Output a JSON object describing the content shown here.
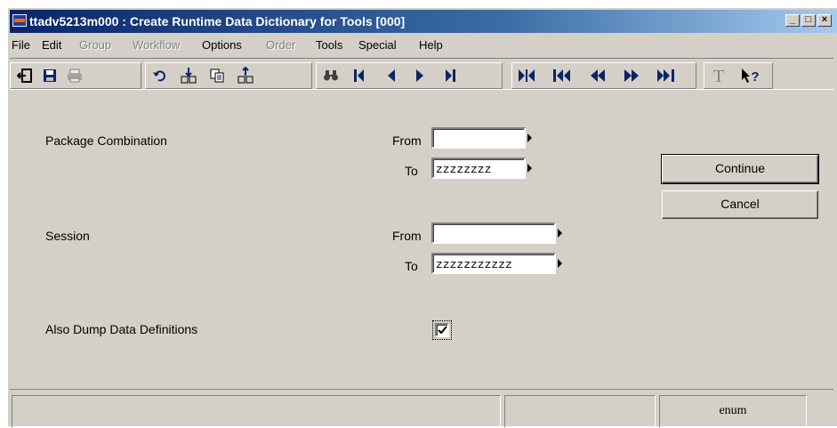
{
  "window": {
    "title": "ttadv5213m000 : Create Runtime Data Dictionary for Tools [000]",
    "minimize": "_",
    "maximize": "□",
    "close": "×"
  },
  "menu": [
    {
      "label": "File",
      "enabled": true
    },
    {
      "label": "Edit",
      "enabled": true
    },
    {
      "label": "Group",
      "enabled": false
    },
    {
      "label": "Workflow",
      "enabled": false
    },
    {
      "label": "Options",
      "enabled": true
    },
    {
      "label": "Order",
      "enabled": false
    },
    {
      "label": "Tools",
      "enabled": true
    },
    {
      "label": "Special",
      "enabled": true
    },
    {
      "label": "Help",
      "enabled": true
    }
  ],
  "form": {
    "package_combination": {
      "label": "Package Combination",
      "from_label": "From",
      "to_label": "To",
      "from_value": "",
      "to_value": "zzzzzzzz"
    },
    "session": {
      "label": "Session",
      "from_label": "From",
      "to_label": "To",
      "from_value": "",
      "to_value": "zzzzzzzzzzz"
    },
    "dump_definitions": {
      "label": "Also Dump Data Definitions",
      "checked": true
    }
  },
  "buttons": {
    "continue": "Continue",
    "cancel": "Cancel"
  },
  "status": {
    "panel1": "",
    "panel2": "",
    "panel3": "enum"
  },
  "colors": {
    "face": "#d4d0c8",
    "title_start": "#0a246a",
    "title_end": "#a6caf0",
    "toolbar_icon": "#0a246a"
  }
}
